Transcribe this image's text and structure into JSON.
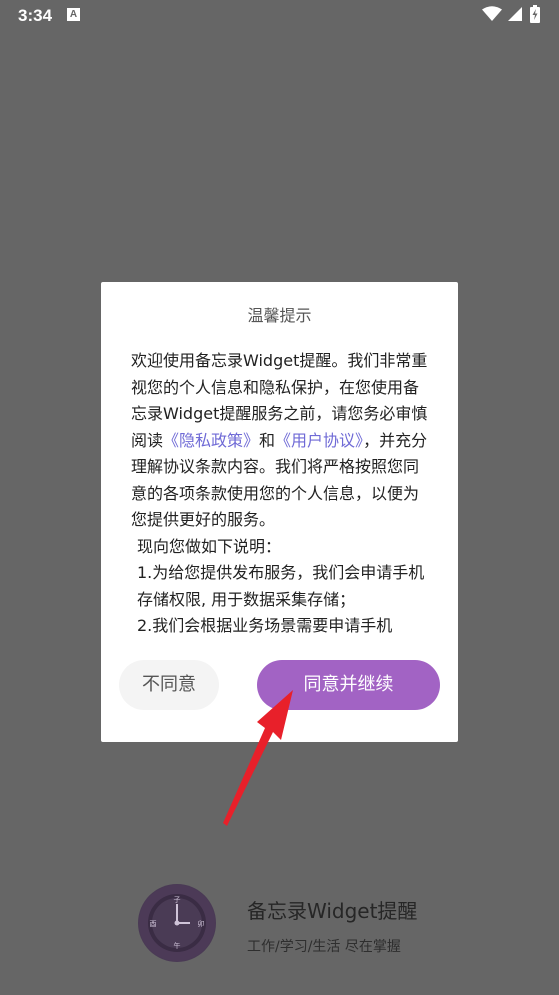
{
  "status_bar": {
    "time": "3:34",
    "notification_icon": "A"
  },
  "dialog": {
    "title": "温馨提示",
    "para1_part1": "欢迎使用备忘录Widget提醒。我们非常重视您的个人信息和隐私保护，在您使用备忘录Widget提醒服务之前，请您务必审慎阅读",
    "privacy_link": "《隐私政策》",
    "and_text": "和",
    "user_agreement_link": "《用户协议》",
    "para1_part2": "，并充分理解协议条款内容。我们将严格按照您同意的各项条款使用您的个人信息，以便为您提供更好的服务。",
    "para2": "现向您做如下说明：",
    "para3": "1.为给您提供发布服务，我们会申请手机存储权限, 用于数据采集存储；",
    "para4": "2.我们会根据业务场景需要申请手机",
    "disagree_label": "不同意",
    "agree_label": "同意并继续"
  },
  "app": {
    "name": "备忘录Widget提醒",
    "tagline": "工作/学习/生活 尽在掌握",
    "logo_chars": [
      "子",
      "卯",
      "午",
      "酉"
    ]
  },
  "colors": {
    "overlay_bg": "#666666",
    "accent": "#a263c4",
    "link": "#6f6ad6",
    "arrow": "#e8202a"
  }
}
